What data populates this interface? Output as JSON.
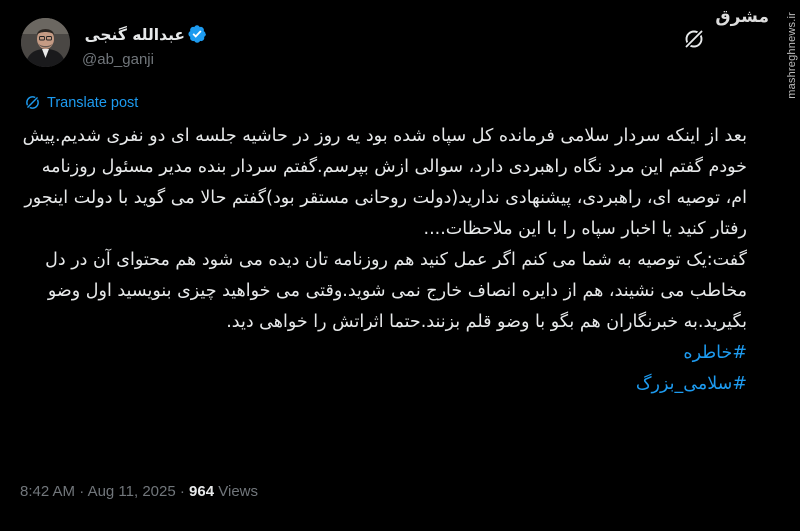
{
  "author": {
    "name": "عبدالله گنجی",
    "handle": "@ab_ganji"
  },
  "watermark": {
    "brand": "مشرق",
    "site": "mashreghnews.ir"
  },
  "translate_label": "Translate post",
  "body": {
    "paragraph1": "بعد از اینکه سردار سلامی فرمانده کل سپاه شده بود یه روز در حاشیه جلسه ای دو نفری شدیم.پیش خودم گفتم این مرد نگاه راهبردی دارد، سوالی ازش بپرسم.گفتم سردار بنده مدیر مسئول روزنامه ام، توصیه ای، راهبردی، پیشنهادی ندارید(دولت روحانی مستقر بود)گفتم حالا می گوید با دولت اینجور رفتار کنید یا اخبار سپاه را با این ملاحظات....",
    "paragraph2": "گفت:یک توصیه به شما می کنم اگر عمل کنید هم روزنامه تان دیده می شود هم محتوای آن در دل مخاطب می نشیند، هم از دایره انصاف خارج نمی شوید.وقتی می خواهید چیزی بنویسید اول وضو بگیرید.به خبرنگاران هم بگو با وضو قلم بزنند.حتما اثراتش را خواهی دید.",
    "hashtag1": "#خاطره",
    "hashtag2": "#سلامی_بزرگ"
  },
  "meta": {
    "time": "8:42 AM",
    "separator": "·",
    "date": "Aug 11, 2025",
    "views_count": "964",
    "views_label": "Views"
  },
  "colors": {
    "background": "#000000",
    "text": "#e7e9ea",
    "muted": "#71767b",
    "link": "#1d9bf0"
  }
}
